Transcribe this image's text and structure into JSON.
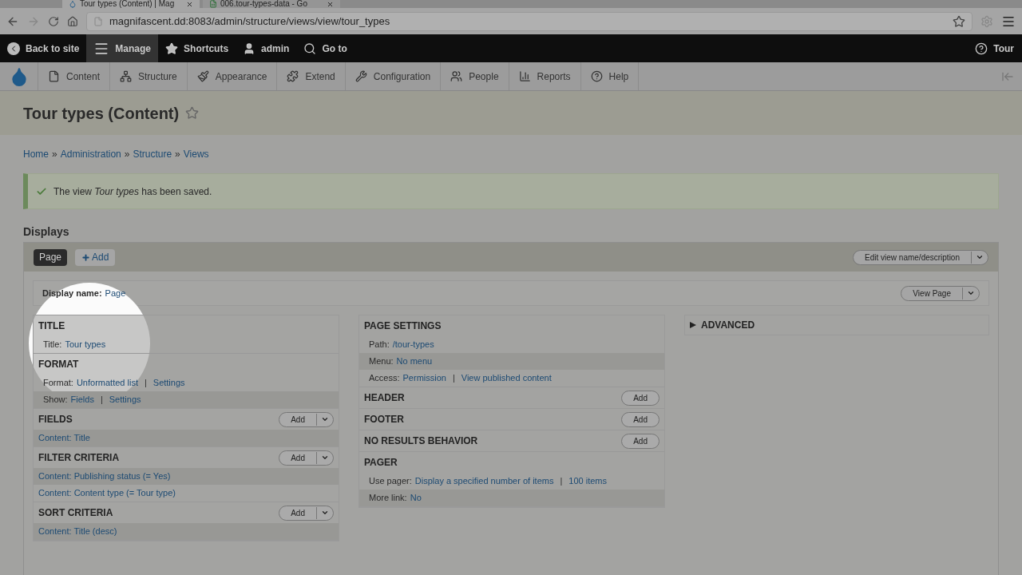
{
  "browser": {
    "tabs": [
      {
        "title": "Tour types (Content) | Mag",
        "selected": true
      },
      {
        "title": "006.tour-types-data - Go",
        "selected": false
      }
    ],
    "url": "magnifascent.dd:8083/admin/structure/views/view/tour_types"
  },
  "toolbar": {
    "items": [
      {
        "label": "Back to site",
        "kind": "back",
        "selected": false
      },
      {
        "label": "Manage",
        "kind": "manage",
        "selected": true
      },
      {
        "label": "Shortcuts",
        "kind": "star",
        "selected": false
      },
      {
        "label": "admin",
        "kind": "user",
        "selected": false
      },
      {
        "label": "Go to",
        "kind": "goto",
        "selected": false
      }
    ],
    "tour": "Tour"
  },
  "admin_menu": [
    {
      "label": "Content",
      "kind": "content"
    },
    {
      "label": "Structure",
      "kind": "structure"
    },
    {
      "label": "Appearance",
      "kind": "appearance"
    },
    {
      "label": "Extend",
      "kind": "extend"
    },
    {
      "label": "Configuration",
      "kind": "configuration"
    },
    {
      "label": "People",
      "kind": "people"
    },
    {
      "label": "Reports",
      "kind": "reports"
    },
    {
      "label": "Help",
      "kind": "help"
    }
  ],
  "page_title": "Tour types (Content)",
  "breadcrumbs": [
    {
      "text": "Home"
    },
    {
      "sep": "»",
      "text": "Administration"
    },
    {
      "sep": "»",
      "text": "Structure"
    },
    {
      "sep": "»",
      "text": "Views"
    }
  ],
  "message": "The view *Tour types* has been saved.",
  "displays": {
    "heading": "Displays",
    "tabs": [
      {
        "label": "Page",
        "selected": true
      }
    ],
    "add": "Add",
    "edit_button": "Edit view name/description",
    "display_name": {
      "label": "Display name:",
      "value": "Page"
    },
    "view_button": "View Page"
  },
  "left_sections": [
    {
      "title": "TITLE",
      "rows": [
        {
          "label": "Title:",
          "links": [
            {
              "text": "Tour types"
            }
          ]
        }
      ]
    },
    {
      "title": "FORMAT",
      "rows": [
        {
          "label": "Format:",
          "links": [
            {
              "text": "Unformatted list"
            },
            {
              "sep": "|",
              "text": "Settings"
            }
          ]
        },
        {
          "label": "Show:",
          "links": [
            {
              "text": "Fields"
            },
            {
              "sep": "|",
              "text": "Settings"
            }
          ]
        }
      ]
    },
    {
      "title": "FIELDS",
      "add": "Add",
      "kind": "split",
      "rows": [
        {
          "links": [
            {
              "text": "Content: Title"
            }
          ]
        }
      ]
    },
    {
      "title": "FILTER CRITERIA",
      "add": "Add",
      "kind": "split",
      "rows": [
        {
          "links": [
            {
              "text": "Content: Publishing status (= Yes)"
            }
          ]
        },
        {
          "links": [
            {
              "text": "Content: Content type (= Tour type)"
            }
          ]
        }
      ]
    },
    {
      "title": "SORT CRITERIA",
      "add": "Add",
      "kind": "split",
      "rows": [
        {
          "links": [
            {
              "text": "Content: Title (desc)"
            }
          ]
        }
      ]
    }
  ],
  "right_sections": [
    {
      "title": "PAGE SETTINGS",
      "rows": [
        {
          "label": "Path:",
          "links": [
            {
              "text": "/tour-types"
            }
          ]
        },
        {
          "label": "Menu:",
          "links": [
            {
              "text": "No menu"
            }
          ]
        },
        {
          "label": "Access:",
          "links": [
            {
              "text": "Permission"
            },
            {
              "sep": "|",
              "text": "View published content"
            }
          ]
        }
      ]
    },
    {
      "title": "HEADER",
      "add": "Add",
      "kind": "button"
    },
    {
      "title": "FOOTER",
      "add": "Add",
      "kind": "button"
    },
    {
      "title": "NO RESULTS BEHAVIOR",
      "add": "Add",
      "kind": "button"
    },
    {
      "title": "PAGER",
      "rows": [
        {
          "label": "Use pager:",
          "links": [
            {
              "text": "Display a specified number of items"
            },
            {
              "sep": "|",
              "text": "100 items"
            }
          ]
        },
        {
          "label": "More link:",
          "links": [
            {
              "text": "No"
            }
          ]
        }
      ]
    }
  ],
  "advanced": {
    "label": "ADVANCED",
    "expanded": false
  }
}
